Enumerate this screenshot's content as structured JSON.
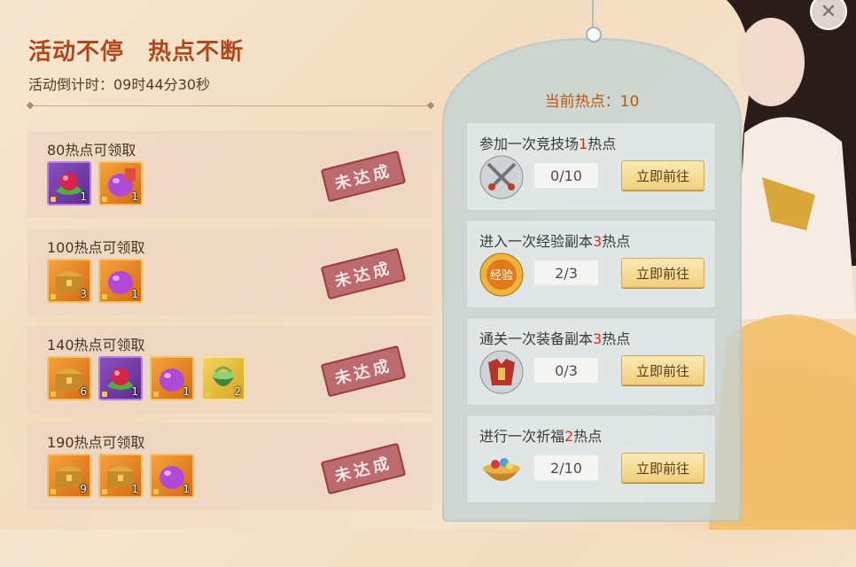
{
  "header": {
    "title": "活动不停　热点不断",
    "countdown_label": "活动倒计时：09时44分30秒"
  },
  "rewards": [
    {
      "label": "80热点可领取",
      "stamp": "未达成",
      "items": [
        {
          "icon": "red-berry-leaf-icon",
          "count": "1"
        },
        {
          "icon": "purple-pill-icon",
          "count": "1"
        }
      ]
    },
    {
      "label": "100热点可领取",
      "stamp": "未达成",
      "items": [
        {
          "icon": "treasure-chest-icon",
          "count": "3"
        },
        {
          "icon": "purple-pill-icon",
          "count": "1"
        }
      ]
    },
    {
      "label": "140热点可领取",
      "stamp": "未达成",
      "items": [
        {
          "icon": "treasure-chest-icon",
          "count": "6"
        },
        {
          "icon": "red-berry-leaf-icon",
          "count": "1"
        },
        {
          "icon": "purple-pill-icon",
          "count": "1"
        },
        {
          "icon": "jade-bowl-icon",
          "count": "2"
        }
      ]
    },
    {
      "label": "190热点可领取",
      "stamp": "未达成",
      "items": [
        {
          "icon": "treasure-chest-icon",
          "count": "9"
        },
        {
          "icon": "treasure-chest-icon",
          "count": "1"
        },
        {
          "icon": "purple-pill-icon",
          "count": "1"
        }
      ]
    }
  ],
  "hot_panel": {
    "current_label": "当前热点：10",
    "tasks": [
      {
        "prefix": "参加一次竞技场",
        "points": "1",
        "suffix": "热点",
        "progress": "0/10",
        "button": "立即前往",
        "icon": "crossed-swords-icon"
      },
      {
        "prefix": "进入一次经验副本",
        "points": "3",
        "suffix": "热点",
        "progress": "2/3",
        "button": "立即前往",
        "icon": "exp-badge-icon"
      },
      {
        "prefix": "通关一次装备副本",
        "points": "3",
        "suffix": "热点",
        "progress": "0/3",
        "button": "立即前往",
        "icon": "armor-icon"
      },
      {
        "prefix": "进行一次祈福",
        "points": "2",
        "suffix": "热点",
        "progress": "2/10",
        "button": "立即前往",
        "icon": "treasure-bowl-icon"
      }
    ]
  },
  "close_label": "✕",
  "colors": {
    "title": "#b5461a",
    "points": "#d8321c",
    "stamp": "#9c3b40"
  }
}
